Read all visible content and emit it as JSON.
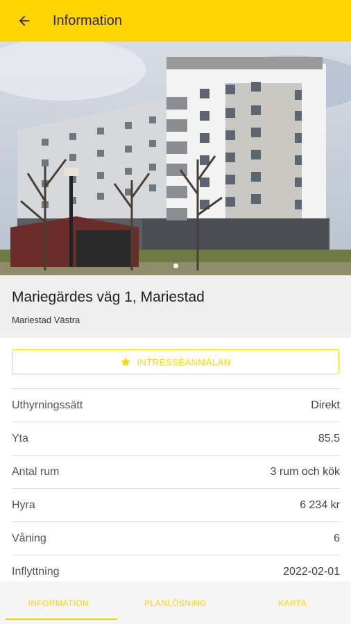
{
  "appbar": {
    "title": "Information",
    "back_icon": "arrow-left-icon"
  },
  "photo": {
    "page_indicator": {
      "count": 1,
      "active": 0
    }
  },
  "listing": {
    "address": "Mariegärdes väg 1, Mariestad",
    "area": "Mariestad Västra"
  },
  "cta": {
    "label": "INTRESSEANMÄLAN",
    "icon": "star-icon"
  },
  "details": [
    {
      "label": "Uthyrningssätt",
      "value": "Direkt"
    },
    {
      "label": "Yta",
      "value": "85.5"
    },
    {
      "label": "Antal rum",
      "value": "3 rum och kök"
    },
    {
      "label": "Hyra",
      "value": "6 234 kr"
    },
    {
      "label": "Våning",
      "value": "6"
    },
    {
      "label": "Inflyttning",
      "value": "2022-02-01"
    }
  ],
  "tabs": [
    {
      "label": "INFORMATION",
      "active": true
    },
    {
      "label": "PLANLÖSNING",
      "active": false
    },
    {
      "label": "KARTA",
      "active": false
    }
  ],
  "colors": {
    "accent": "#FFD500"
  }
}
